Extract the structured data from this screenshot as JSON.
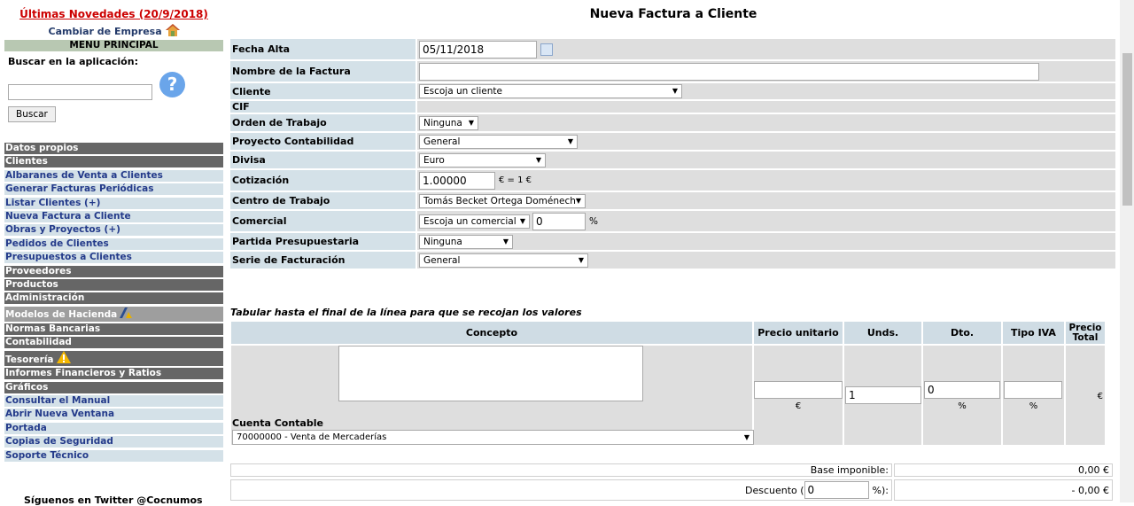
{
  "sidebar": {
    "news_link": "Últimas Novedades (20/9/2018)",
    "change_company": "Cambiar de Empresa",
    "menu_title": "MENU PRINCIPAL",
    "search_label": "Buscar en la aplicación:",
    "search_button": "Buscar",
    "help_icon": "?",
    "items": [
      {
        "label": "Datos propios",
        "type": "section"
      },
      {
        "label": "Clientes",
        "type": "section"
      },
      {
        "label": "Albaranes de Venta a Clientes",
        "type": "sub"
      },
      {
        "label": "Generar Facturas Periódicas",
        "type": "sub"
      },
      {
        "label": "Listar Clientes (+)",
        "type": "sub"
      },
      {
        "label": "Nueva Factura a Cliente",
        "type": "sub"
      },
      {
        "label": "Obras y Proyectos (+)",
        "type": "sub"
      },
      {
        "label": "Pedidos de Clientes",
        "type": "sub"
      },
      {
        "label": "Presupuestos a Clientes",
        "type": "sub"
      },
      {
        "label": "Proveedores",
        "type": "section"
      },
      {
        "label": "Productos",
        "type": "section"
      },
      {
        "label": "Administración",
        "type": "section"
      },
      {
        "label": "Modelos de Hacienda",
        "type": "light"
      },
      {
        "label": "Normas Bancarias",
        "type": "section"
      },
      {
        "label": "Contabilidad",
        "type": "section"
      },
      {
        "label": "Tesorería",
        "type": "section"
      },
      {
        "label": "Informes Financieros y Ratios",
        "type": "section"
      },
      {
        "label": "Gráficos",
        "type": "section"
      },
      {
        "label": "Consultar el Manual",
        "type": "sub"
      },
      {
        "label": "Abrir Nueva Ventana",
        "type": "sub"
      },
      {
        "label": "Portada",
        "type": "sub"
      },
      {
        "label": "Copias de Seguridad",
        "type": "sub"
      },
      {
        "label": "Soporte Técnico",
        "type": "sub"
      }
    ],
    "twitter": "Síguenos en Twitter @Cocnumos"
  },
  "page": {
    "title": "Nueva Factura a Cliente"
  },
  "form": {
    "fecha_alta_label": "Fecha Alta",
    "fecha_alta_value": "05/11/2018",
    "nombre_label": "Nombre de la Factura",
    "nombre_value": "",
    "cliente_label": "Cliente",
    "cliente_value": "Escoja un cliente",
    "cif_label": "CIF",
    "orden_label": "Orden de Trabajo",
    "orden_value": "Ninguna",
    "proyecto_label": "Proyecto Contabilidad",
    "proyecto_value": "General",
    "divisa_label": "Divisa",
    "divisa_value": "Euro",
    "cotizacion_label": "Cotización",
    "cotizacion_value": "1.00000",
    "cotizacion_suffix": "€ = 1 €",
    "centro_label": "Centro de Trabajo",
    "centro_value": "Tomás Becket Ortega Doménech",
    "comercial_label": "Comercial",
    "comercial_value": "Escoja un comercial",
    "comercial_pct": "0",
    "comercial_pct_symbol": "%",
    "partida_label": "Partida Presupuestaria",
    "partida_value": "Ninguna",
    "serie_label": "Serie de Facturación",
    "serie_value": "General"
  },
  "lines": {
    "note": "Tabular hasta el final de la línea para que se recojan los valores",
    "headers": {
      "concepto": "Concepto",
      "precio_unitario": "Precio unitario",
      "unds": "Unds.",
      "dto": "Dto.",
      "tipo_iva": "Tipo IVA",
      "precio_total": "Precio Total"
    },
    "cuenta_label": "Cuenta Contable",
    "cuenta_value": "70000000 - Venta de Mercaderías",
    "precio_value": "",
    "precio_unit": "€",
    "unds_value": "1",
    "dto_value": "0",
    "dto_unit": "%",
    "iva_value": "",
    "iva_unit": "%",
    "total_unit": "€"
  },
  "totals": {
    "base_label": "Base imponible:",
    "base_value": "0,00 €",
    "descuento_label": "Descuento (",
    "descuento_value": "0",
    "descuento_suffix": "%):",
    "descuento_amount": "- 0,00 €"
  }
}
